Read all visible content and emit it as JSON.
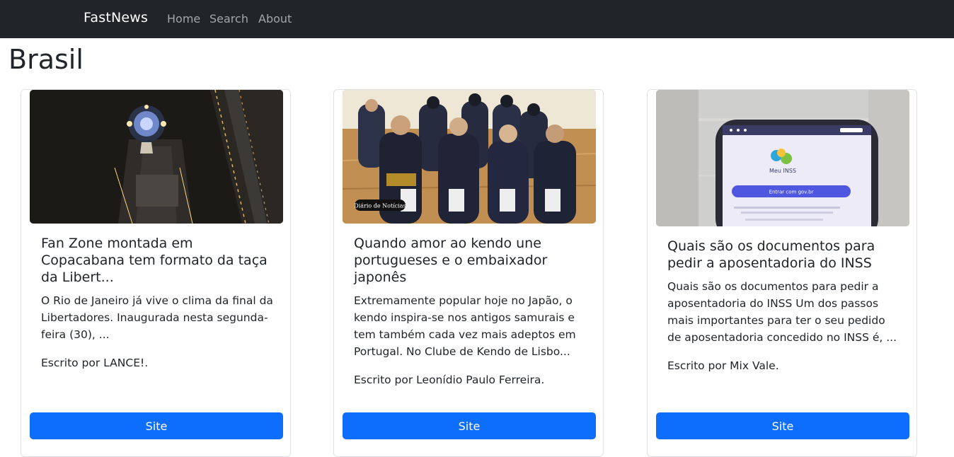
{
  "navbar": {
    "brand": "FastNews",
    "links": [
      "Home",
      "Search",
      "About"
    ]
  },
  "page": {
    "title": "Brasil"
  },
  "articles": [
    {
      "title": "Fan Zone montada em Copacabana tem formato da taça da Libert...",
      "description": "O Rio de Janeiro já vive o clima da final da Libertadores. Inaugurada nesta segunda-feira (30), ...",
      "author": "Escrito por LANCE!.",
      "button": "Site",
      "image_caption": ""
    },
    {
      "title": "Quando amor ao kendo une portugueses e o embaixador japonês",
      "description": "Extremamente popular hoje no Japão, o kendo inspira-se nos antigos samurais e tem também cada vez mais adeptos em Portugal. No Clube de Kendo de Lisbo...",
      "author": "Escrito por Leonídio Paulo Ferreira.",
      "button": "Site",
      "image_caption": "Diário de Notícias"
    },
    {
      "title": "Quais são os documentos para pedir a aposentadoria do INSS",
      "description": "Quais são os documentos para pedir a aposentadoria do INSS Um dos passos mais importantes para ter o seu pedido de aposentadoria concedido no INSS é, ...",
      "author": "Escrito por Mix Vale.",
      "button": "Site",
      "image_caption": "",
      "image_app_name": "Meu INSS",
      "image_app_button": "Entrar com gov.br"
    }
  ],
  "colors": {
    "navbar": "#212529",
    "primary": "#0d6efd",
    "nav_link": "#a2a5a9"
  }
}
